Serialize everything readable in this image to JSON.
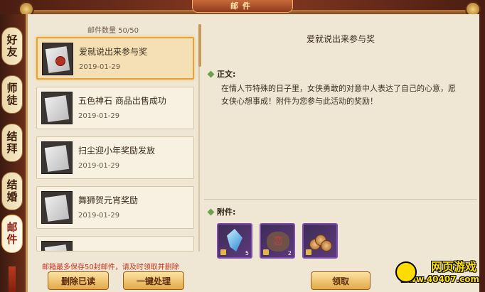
{
  "window": {
    "title": "邮件"
  },
  "tabs": [
    {
      "label": "好友",
      "active": false
    },
    {
      "label": "师徒",
      "active": false
    },
    {
      "label": "结拜",
      "active": false
    },
    {
      "label": "结婚",
      "active": false
    },
    {
      "label": "邮件",
      "active": true
    }
  ],
  "mail_list": {
    "count_label": "邮件数量 50/50",
    "items": [
      {
        "title": "爱就说出来参与奖",
        "date": "2019-01-29",
        "selected": true
      },
      {
        "title": "五色神石 商品出售成功",
        "date": "2019-01-29",
        "selected": false
      },
      {
        "title": "扫尘迎小年奖励发放",
        "date": "2019-01-29",
        "selected": false
      },
      {
        "title": "舞狮贺元宵奖励",
        "date": "2019-01-29",
        "selected": false
      }
    ],
    "warning": "邮箱最多保存50封邮件，请及时领取并删除",
    "delete_read_label": "删除已读",
    "process_all_label": "一键处理"
  },
  "detail": {
    "title": "爱就说出来参与奖",
    "body_label": "正文:",
    "body_text": "在情人节特殊的日子里，女侠勇敢的对意中人表达了自己的心意，愿女侠心想事成！附件为您参与此活动的奖励！",
    "attachments_label": "附件:",
    "attachments": [
      {
        "icon": "crystal-icon",
        "quantity": "5"
      },
      {
        "icon": "stone-icon",
        "quantity": "2",
        "glyph": "恋"
      },
      {
        "icon": "coins-icon",
        "quantity": ""
      }
    ],
    "claim_label": "领取"
  },
  "watermark": {
    "top": "网页游戏",
    "url": "www.40407.com"
  },
  "colors": {
    "accent": "#e6a33a",
    "warning": "#c2351f",
    "panel_bg": "#efe6d4"
  }
}
